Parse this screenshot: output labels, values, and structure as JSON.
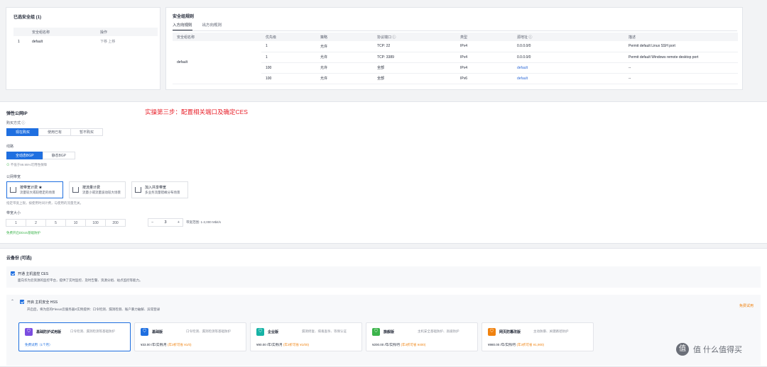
{
  "selected_sg": {
    "title": "已选安全组 (1)",
    "columns": [
      "安全组名称",
      "操作"
    ],
    "rows": [
      {
        "index": "1",
        "name": "default",
        "actions": "下移  上移"
      }
    ]
  },
  "sg_rules": {
    "title": "安全组规则",
    "tabs": [
      "入方向规则",
      "出方向规则"
    ],
    "columns": [
      "安全组名称",
      "优先级",
      "策略",
      "协议端口 ⓘ",
      "类型",
      "源地址 ⓘ",
      "描述"
    ],
    "group_name": "default",
    "rows": [
      {
        "priority": "1",
        "policy": "允许",
        "port": "TCP: 22",
        "type": "IPv4",
        "source": "0.0.0.0/0",
        "desc": "Permit default Linux SSH port"
      },
      {
        "priority": "1",
        "policy": "允许",
        "port": "TCP: 3389",
        "type": "IPv4",
        "source": "0.0.0.0/0",
        "desc": "Permit default Windows remote desktop port"
      },
      {
        "priority": "100",
        "policy": "允许",
        "port": "全部",
        "type": "IPv4",
        "source": "default",
        "desc": "--"
      },
      {
        "priority": "100",
        "policy": "允许",
        "port": "全部",
        "type": "IPv6",
        "source": "default",
        "desc": "--"
      }
    ]
  },
  "eip": {
    "title": "弹性公网IP",
    "annotation": "实操第三步：配置相关端口及确定CES",
    "purchase_mode_label": "购买方式 ⓘ",
    "purchase_modes": [
      "现在购买",
      "使用已有",
      "暂不购买"
    ],
    "line_label": "线路",
    "lines": [
      "全动态BGP",
      "静态BGP"
    ],
    "sla_note": "不低于99.95%可用性保障",
    "bandwidth_label": "公网带宽",
    "bandwidth_types": [
      {
        "name": "按带宽计费 ★",
        "desc": "流量较大或较稳定的场景"
      },
      {
        "name": "按流量计费",
        "desc": "流量小或流量波动较大场景"
      },
      {
        "name": "加入共享带宽",
        "desc": "多业务流量错峰分布场景"
      }
    ],
    "bandwidth_note": "指定带宽上限，按使用时间计费，与使用的流量无关。",
    "size_label": "带宽大小",
    "sizes": [
      "1",
      "2",
      "5",
      "10",
      "100",
      "200"
    ],
    "size_value": "3",
    "size_range": "带宽范围: 1-2,000 Mbit/s",
    "ddos_note": "免费开启DDoS基础防护"
  },
  "cloud_backup": {
    "title": "云备份 (可选)",
    "ces_label": "开通 主机监控 CES",
    "ces_desc": "面向华为云资源的监控平台，提供了实时监控、及时告警、资源分组、站点监控等能力。",
    "hss_label": "开启 主机安全 HSS",
    "hss_desc": "开启后，将为您的Flexus云服务器X实例提供：口令检测、漏洞检测、账户暴力破解、异常登录",
    "hss_link": "免费试用"
  },
  "editions": [
    {
      "name": "基础防护试用版",
      "desc": "口令检测、漏洞检测等基础防护",
      "price": "",
      "free": "免费试用（1个月）",
      "discount": "",
      "color": "#7b4de0"
    },
    {
      "name": "基础版",
      "desc": "口令检测、漏洞检测等基础防护",
      "price": "¥33.00 /年/实例/月",
      "free": "",
      "discount": "(年3折可省 ¥1/0)",
      "color": "#1f6fe0"
    },
    {
      "name": "企业版",
      "desc": "漏洞修复、病毒查杀、等保认证",
      "price": "¥90.00 /年/实例/月",
      "free": "",
      "discount": "(年3折可省 ¥1/00)",
      "color": "#17b3a6"
    },
    {
      "name": "旗舰版",
      "desc": "主机安全基础防护、高级防护",
      "price": "¥200.00 /年/实例/月",
      "free": "",
      "discount": "(年3折可省 ¥400)",
      "color": "#3cb44b"
    },
    {
      "name": "网页防篡改版",
      "desc": "主动防御、关键路径防护",
      "price": "¥980.00 /年/实例/月",
      "free": "",
      "discount": "(年3折可省 ¥1,900)",
      "color": "#f0820f"
    }
  ],
  "watermark": "值 什么值得买"
}
